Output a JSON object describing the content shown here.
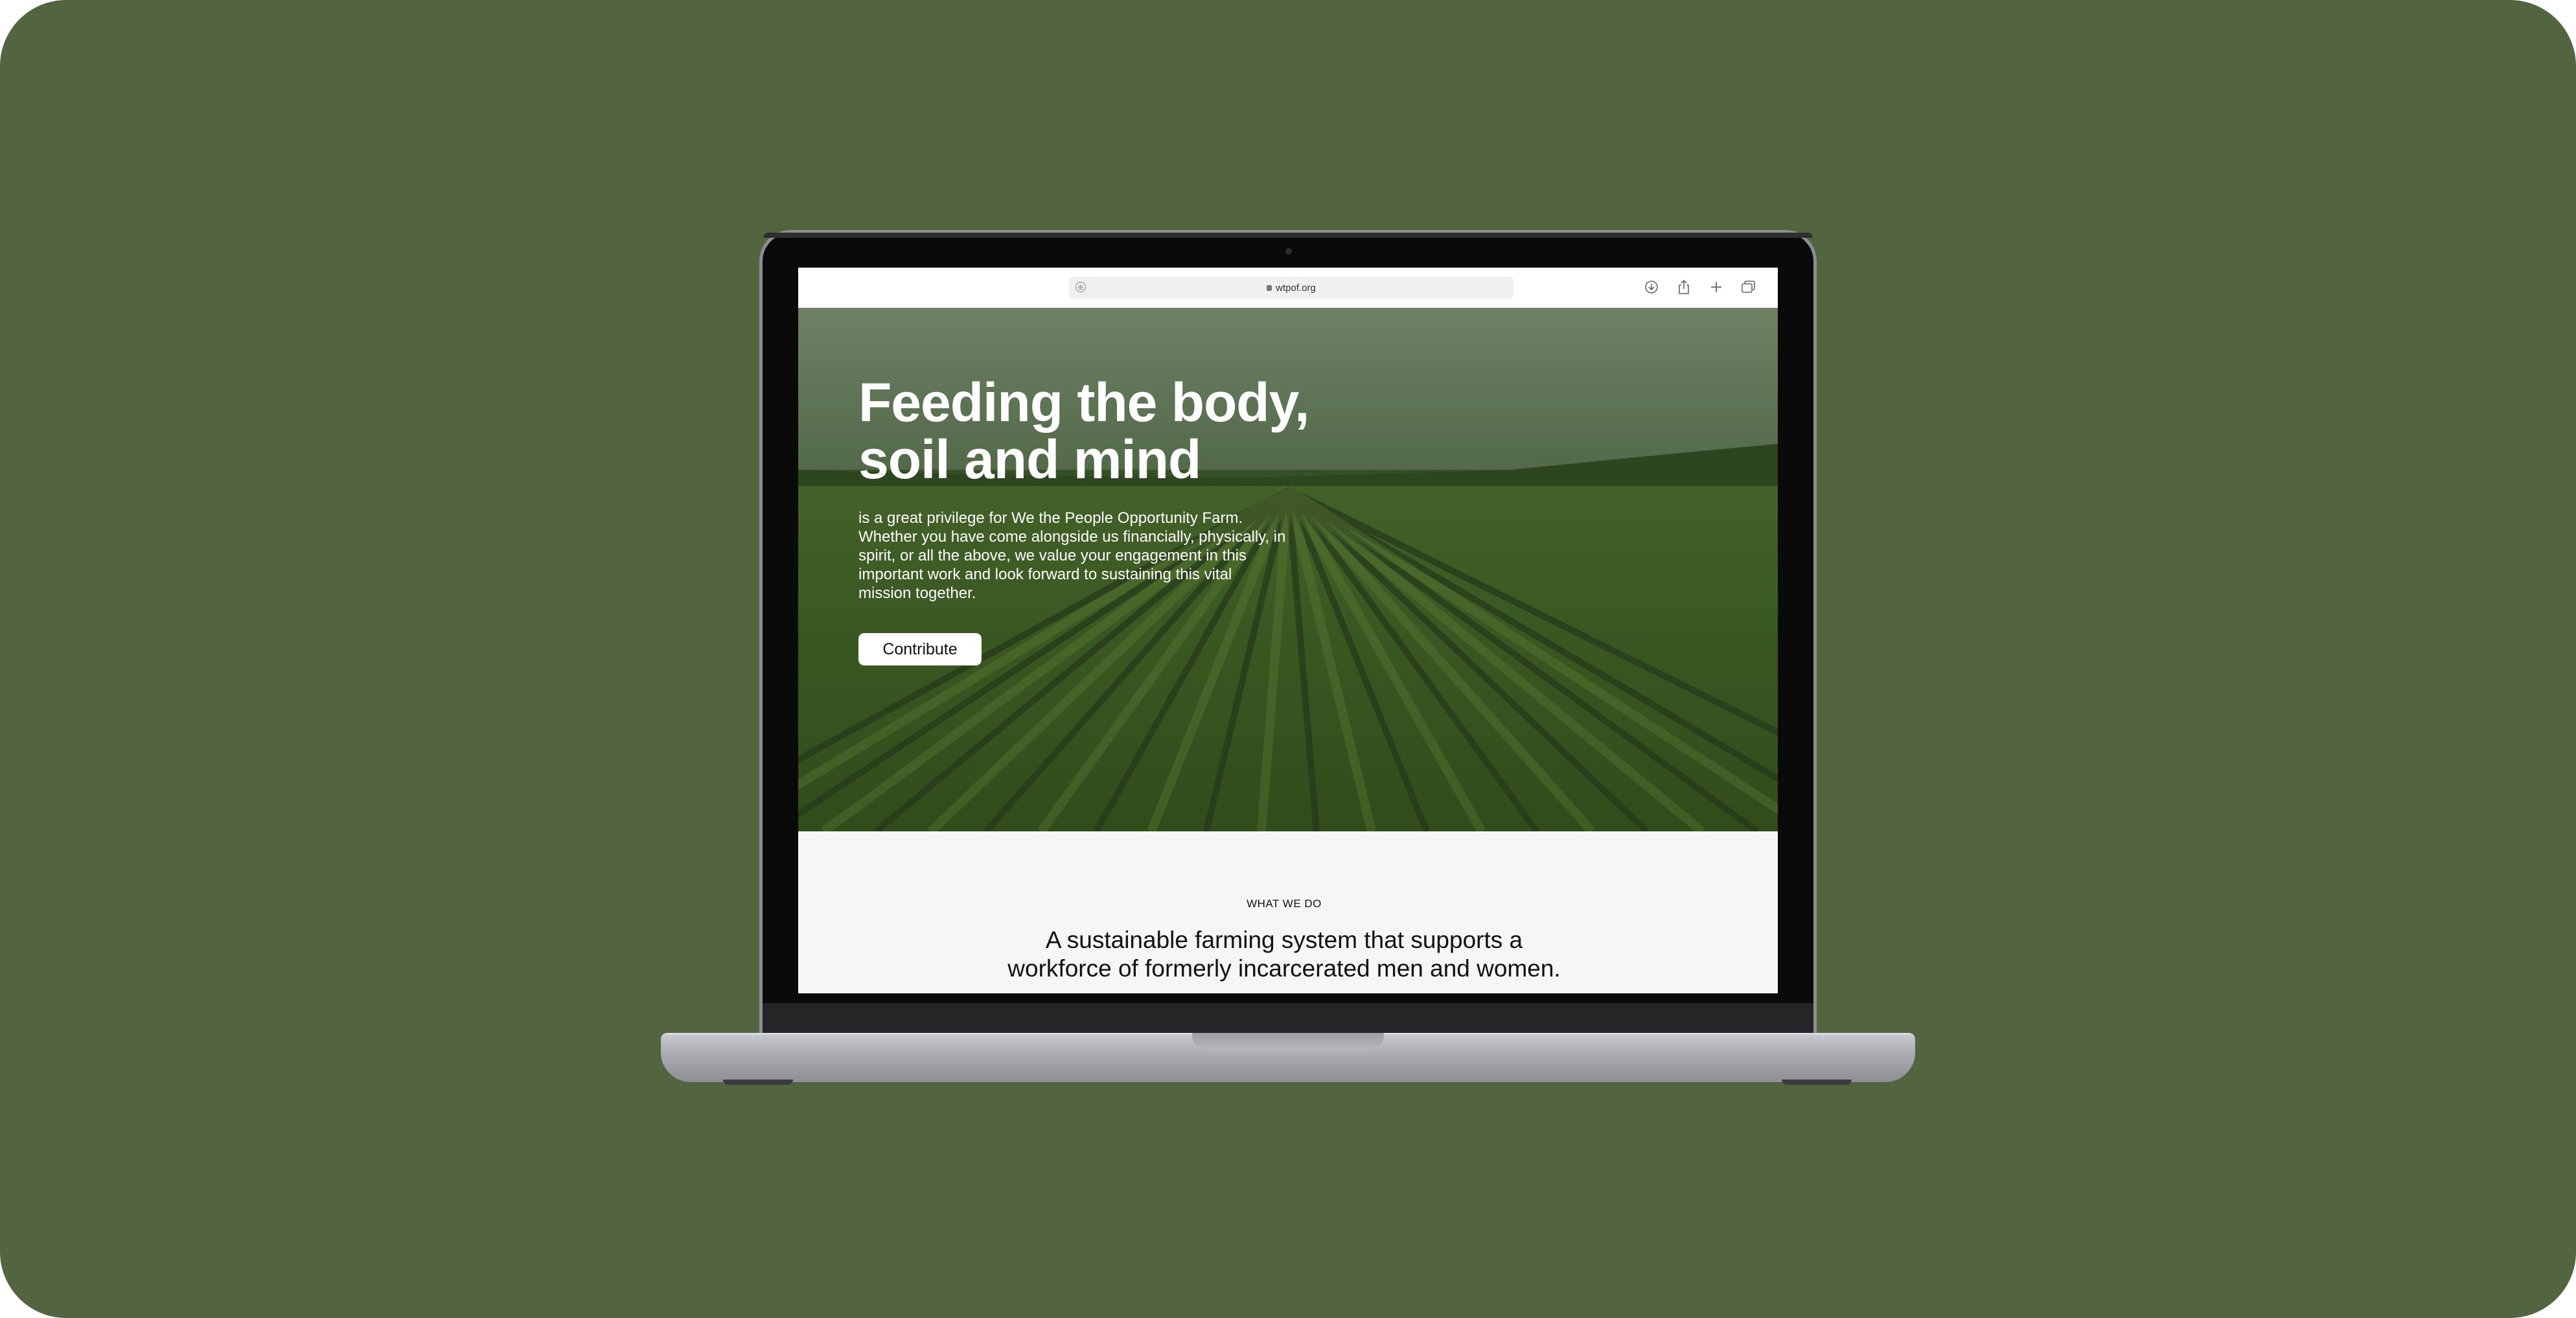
{
  "browser": {
    "url": "wtpof.org",
    "icons": [
      "address-site-icon",
      "lock-icon",
      "download-icon",
      "share-icon",
      "new-tab-icon",
      "tabs-overview-icon"
    ]
  },
  "hero": {
    "title_line1": "Feeding the body,",
    "title_line2": "soil and mind",
    "body": "is a great privilege for We the People Opportunity Farm. Whether you have come alongside us financially, physically, in spirit, or all the above, we value your engagement in this important work and look forward to sustaining this vital mission together.",
    "cta_label": "Contribute"
  },
  "what_we_do": {
    "eyebrow": "WHAT WE DO",
    "title_line1": "A sustainable farming system that supports a",
    "title_line2": "workforce of formerly incarcerated men and women."
  },
  "colors": {
    "background": "#536540",
    "hero_tint": "#3c5a2c",
    "button_bg": "#ffffff",
    "section_bg": "#f6f6f6"
  }
}
